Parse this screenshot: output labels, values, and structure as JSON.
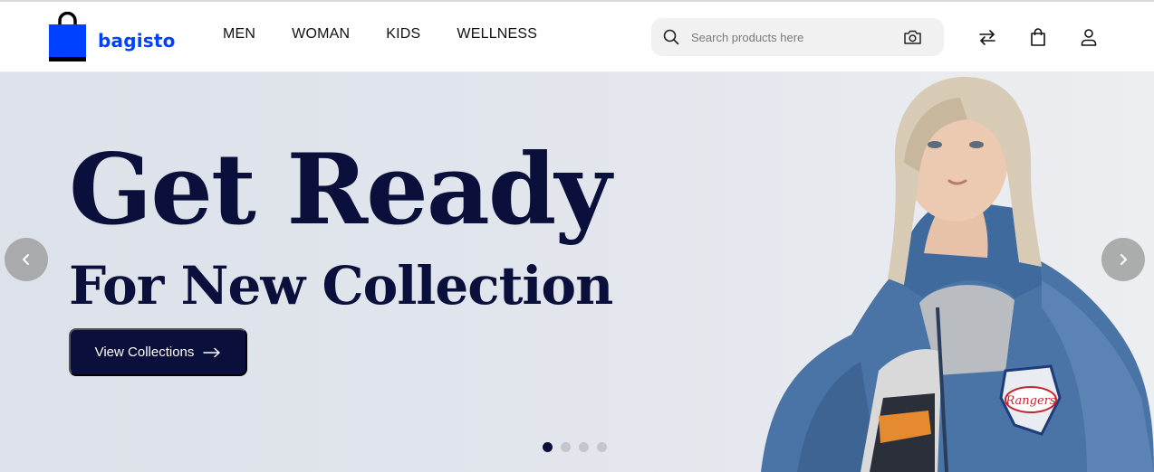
{
  "brand": {
    "name": "bagisto",
    "accent": "#0041ff"
  },
  "nav": {
    "items": [
      {
        "label": "MEN"
      },
      {
        "label": "WOMAN"
      },
      {
        "label": "KIDS"
      },
      {
        "label": "WELLNESS"
      }
    ]
  },
  "search": {
    "placeholder": "Search products here",
    "icon": "search-icon",
    "camera_icon": "camera-icon"
  },
  "header_icons": [
    "compare-icon",
    "cart-icon",
    "user-icon"
  ],
  "hero": {
    "headline": "Get Ready",
    "subheadline": "For New Collection",
    "cta_label": "View Collections",
    "slides_total": 4,
    "active_slide": 1,
    "colors": {
      "headline": "#0b0f3c",
      "cta_bg": "#0b0f3c"
    }
  }
}
